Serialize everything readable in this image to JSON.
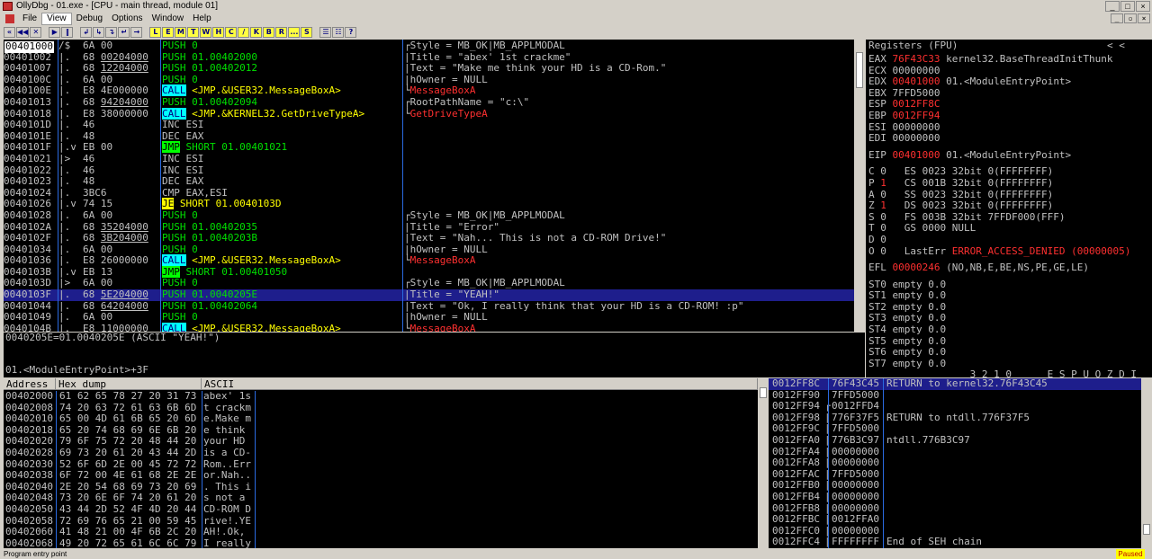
{
  "window": {
    "title": "OllyDbg - 01.exe - [CPU - main thread, module 01]"
  },
  "menu": [
    "File",
    "View",
    "Debug",
    "Options",
    "Window",
    "Help"
  ],
  "toolbar": {
    "buttons": [
      "«",
      "◀◀",
      "✕",
      "▶",
      "‖",
      "↲",
      "↳",
      "↴",
      "↵",
      "→"
    ],
    "letters": [
      "L",
      "E",
      "M",
      "T",
      "W",
      "H",
      "C",
      "/",
      "K",
      "B",
      "R",
      "...",
      "S"
    ],
    "right": [
      "☰",
      "☷",
      "?"
    ]
  },
  "disasm": {
    "rows": [
      {
        "addr": "00401000",
        "mark": "/$",
        "hex": "6A 00",
        "hexul": "",
        "asm": [
          {
            "t": "PUSH 0",
            "c": "g"
          }
        ],
        "cmt": [
          {
            "t": "┌Style = MB_OK|MB_APPLMODAL",
            "c": "w"
          }
        ]
      },
      {
        "addr": "00401002",
        "mark": "|.",
        "hex": "68 ",
        "hexul": "00204000",
        "asm": [
          {
            "t": "PUSH 01.00402000",
            "c": "g"
          }
        ],
        "cmt": [
          {
            "t": "|Title = \"abex' 1st crackme\"",
            "c": "w"
          }
        ]
      },
      {
        "addr": "00401007",
        "mark": "|.",
        "hex": "68 ",
        "hexul": "12204000",
        "asm": [
          {
            "t": "PUSH 01.00402012",
            "c": "g"
          }
        ],
        "cmt": [
          {
            "t": "|Text = \"Make me think your HD is a CD-Rom.\"",
            "c": "w"
          }
        ]
      },
      {
        "addr": "0040100C",
        "mark": "|.",
        "hex": "6A 00",
        "hexul": "",
        "asm": [
          {
            "t": "PUSH 0",
            "c": "g"
          }
        ],
        "cmt": [
          {
            "t": "|hOwner = NULL",
            "c": "w"
          }
        ]
      },
      {
        "addr": "0040100E",
        "mark": "|.",
        "hex": "E8 4E000000",
        "hexul": "",
        "asm": [
          {
            "t": "CALL",
            "c": "callhl"
          },
          {
            "t": " <JMP.&USER32.MessageBoxA>",
            "c": "y"
          }
        ],
        "cmt": [
          {
            "t": "└",
            "c": "w"
          },
          {
            "t": "MessageBoxA",
            "c": "r"
          }
        ]
      },
      {
        "addr": "00401013",
        "mark": "|.",
        "hex": "68 ",
        "hexul": "94204000",
        "asm": [
          {
            "t": "PUSH 01.00402094",
            "c": "g"
          }
        ],
        "cmt": [
          {
            "t": "┌RootPathName = \"c:\\\"",
            "c": "w"
          }
        ]
      },
      {
        "addr": "00401018",
        "mark": "|.",
        "hex": "E8 38000000",
        "hexul": "",
        "asm": [
          {
            "t": "CALL",
            "c": "callhl"
          },
          {
            "t": " <JMP.&KERNEL32.GetDriveTypeA>",
            "c": "y"
          }
        ],
        "cmt": [
          {
            "t": "└",
            "c": "w"
          },
          {
            "t": "GetDriveTypeA",
            "c": "r"
          }
        ]
      },
      {
        "addr": "0040101D",
        "mark": "|.",
        "hex": "46",
        "hexul": "",
        "asm": [
          {
            "t": "INC ESI",
            "c": "w"
          }
        ],
        "cmt": []
      },
      {
        "addr": "0040101E",
        "mark": "|.",
        "hex": "48",
        "hexul": "",
        "asm": [
          {
            "t": "DEC EAX",
            "c": "w"
          }
        ],
        "cmt": []
      },
      {
        "addr": "0040101F",
        "mark": "|.v",
        "hex": "EB 00",
        "hexul": "",
        "asm": [
          {
            "t": "JMP",
            "c": "jmphl"
          },
          {
            "t": " SHORT 01.00401021",
            "c": "g"
          }
        ],
        "cmt": []
      },
      {
        "addr": "00401021",
        "mark": "|>",
        "hex": "46",
        "hexul": "",
        "asm": [
          {
            "t": "INC ESI",
            "c": "w"
          }
        ],
        "cmt": []
      },
      {
        "addr": "00401022",
        "mark": "|.",
        "hex": "46",
        "hexul": "",
        "asm": [
          {
            "t": "INC ESI",
            "c": "w"
          }
        ],
        "cmt": []
      },
      {
        "addr": "00401023",
        "mark": "|.",
        "hex": "48",
        "hexul": "",
        "asm": [
          {
            "t": "DEC EAX",
            "c": "w"
          }
        ],
        "cmt": []
      },
      {
        "addr": "00401024",
        "mark": "|.",
        "hex": "3BC6",
        "hexul": "",
        "asm": [
          {
            "t": "CMP EAX,ESI",
            "c": "w"
          }
        ],
        "cmt": []
      },
      {
        "addr": "00401026",
        "mark": "|.v",
        "hex": "74 15",
        "hexul": "",
        "asm": [
          {
            "t": "JE",
            "c": "jehl"
          },
          {
            "t": " SHORT 01.0040103D",
            "c": "y"
          }
        ],
        "cmt": []
      },
      {
        "addr": "00401028",
        "mark": "|.",
        "hex": "6A 00",
        "hexul": "",
        "asm": [
          {
            "t": "PUSH 0",
            "c": "g"
          }
        ],
        "cmt": [
          {
            "t": "┌Style = MB_OK|MB_APPLMODAL",
            "c": "w"
          }
        ]
      },
      {
        "addr": "0040102A",
        "mark": "|.",
        "hex": "68 ",
        "hexul": "35204000",
        "asm": [
          {
            "t": "PUSH 01.00402035",
            "c": "g"
          }
        ],
        "cmt": [
          {
            "t": "|Title = \"Error\"",
            "c": "w"
          }
        ]
      },
      {
        "addr": "0040102F",
        "mark": "|.",
        "hex": "68 ",
        "hexul": "3B204000",
        "asm": [
          {
            "t": "PUSH 01.0040203B",
            "c": "g"
          }
        ],
        "cmt": [
          {
            "t": "|Text = \"Nah... This is not a CD-ROM Drive!\"",
            "c": "w"
          }
        ]
      },
      {
        "addr": "00401034",
        "mark": "|.",
        "hex": "6A 00",
        "hexul": "",
        "asm": [
          {
            "t": "PUSH 0",
            "c": "g"
          }
        ],
        "cmt": [
          {
            "t": "|hOwner = NULL",
            "c": "w"
          }
        ]
      },
      {
        "addr": "00401036",
        "mark": "|.",
        "hex": "E8 26000000",
        "hexul": "",
        "asm": [
          {
            "t": "CALL",
            "c": "callhl"
          },
          {
            "t": " <JMP.&USER32.MessageBoxA>",
            "c": "y"
          }
        ],
        "cmt": [
          {
            "t": "└",
            "c": "w"
          },
          {
            "t": "MessageBoxA",
            "c": "r"
          }
        ]
      },
      {
        "addr": "0040103B",
        "mark": "|.v",
        "hex": "EB 13",
        "hexul": "",
        "asm": [
          {
            "t": "JMP",
            "c": "jmphl"
          },
          {
            "t": " SHORT 01.00401050",
            "c": "g"
          }
        ],
        "cmt": []
      },
      {
        "addr": "0040103D",
        "mark": "|>",
        "hex": "6A 00",
        "hexul": "",
        "asm": [
          {
            "t": "PUSH 0",
            "c": "g"
          }
        ],
        "cmt": [
          {
            "t": "┌Style = MB_OK|MB_APPLMODAL",
            "c": "w"
          }
        ]
      },
      {
        "addr": "0040103F",
        "mark": "|.",
        "hex": "68 ",
        "hexul": "5E204000",
        "asm": [
          {
            "t": "PUSH 01.0040205E",
            "c": "g"
          }
        ],
        "cmt": [
          {
            "t": "|Title = \"YEAH!\"",
            "c": "w"
          }
        ],
        "selected": true
      },
      {
        "addr": "00401044",
        "mark": "|.",
        "hex": "68 ",
        "hexul": "64204000",
        "asm": [
          {
            "t": "PUSH 01.00402064",
            "c": "g"
          }
        ],
        "cmt": [
          {
            "t": "|Text = \"Ok, I really think that your HD is a CD-ROM! :p\"",
            "c": "w"
          }
        ]
      },
      {
        "addr": "00401049",
        "mark": "|.",
        "hex": "6A 00",
        "hexul": "",
        "asm": [
          {
            "t": "PUSH 0",
            "c": "g"
          }
        ],
        "cmt": [
          {
            "t": "|hOwner = NULL",
            "c": "w"
          }
        ]
      },
      {
        "addr": "0040104B",
        "mark": "|.",
        "hex": "E8 11000000",
        "hexul": "",
        "asm": [
          {
            "t": "CALL",
            "c": "callhl"
          },
          {
            "t": " <JMP.&USER32.MessageBoxA>",
            "c": "y"
          }
        ],
        "cmt": [
          {
            "t": "└",
            "c": "w"
          },
          {
            "t": "MessageBoxA",
            "c": "r"
          }
        ]
      }
    ]
  },
  "info": {
    "line1": "0040205E=01.0040205E (ASCII \"YEAH!\")",
    "line2": "01.<ModuleEntryPoint>+3F"
  },
  "registers": {
    "header": "Registers (FPU)",
    "header_arrows": "<          <",
    "lines": [
      [
        {
          "t": "EAX ",
          "c": "w"
        },
        {
          "t": "76F43C33",
          "c": "r"
        },
        {
          "t": " kernel32.BaseThreadInitThunk",
          "c": "w"
        }
      ],
      [
        {
          "t": "ECX 00000000",
          "c": "w"
        }
      ],
      [
        {
          "t": "EDX ",
          "c": "w"
        },
        {
          "t": "00401000",
          "c": "r"
        },
        {
          "t": " 01.<ModuleEntryPoint>",
          "c": "w"
        }
      ],
      [
        {
          "t": "EBX 7FFD5000",
          "c": "w"
        }
      ],
      [
        {
          "t": "ESP ",
          "c": "w"
        },
        {
          "t": "0012FF8C",
          "c": "r"
        }
      ],
      [
        {
          "t": "EBP ",
          "c": "w"
        },
        {
          "t": "0012FF94",
          "c": "r"
        }
      ],
      [
        {
          "t": "ESI 00000000",
          "c": "w"
        }
      ],
      [
        {
          "t": "EDI 00000000",
          "c": "w"
        }
      ],
      [],
      [
        {
          "t": "EIP ",
          "c": "w"
        },
        {
          "t": "00401000",
          "c": "r"
        },
        {
          "t": " 01.<ModuleEntryPoint>",
          "c": "w"
        }
      ],
      [],
      [
        {
          "t": "C 0   ES 0023 32bit 0(FFFFFFFF)",
          "c": "w"
        }
      ],
      [
        {
          "t": "P ",
          "c": "w"
        },
        {
          "t": "1",
          "c": "r"
        },
        {
          "t": "   CS 001B 32bit 0(FFFFFFFF)",
          "c": "w"
        }
      ],
      [
        {
          "t": "A 0   SS 0023 32bit 0(FFFFFFFF)",
          "c": "w"
        }
      ],
      [
        {
          "t": "Z ",
          "c": "w"
        },
        {
          "t": "1",
          "c": "r"
        },
        {
          "t": "   DS 0023 32bit 0(FFFFFFFF)",
          "c": "w"
        }
      ],
      [
        {
          "t": "S 0   FS 003B 32bit 7FFDF000(FFF)",
          "c": "w"
        }
      ],
      [
        {
          "t": "T 0   GS 0000 NULL",
          "c": "w"
        }
      ],
      [
        {
          "t": "D 0",
          "c": "w"
        }
      ],
      [
        {
          "t": "O 0   LastErr ",
          "c": "w"
        },
        {
          "t": "ERROR_ACCESS_DENIED (00000005)",
          "c": "r"
        }
      ],
      [],
      [
        {
          "t": "EFL ",
          "c": "w"
        },
        {
          "t": "00000246",
          "c": "r"
        },
        {
          "t": " (NO,NB,E,BE,NS,PE,GE,LE)",
          "c": "w"
        }
      ],
      [],
      [
        {
          "t": "ST0 empty 0.0",
          "c": "w"
        }
      ],
      [
        {
          "t": "ST1 empty 0.0",
          "c": "w"
        }
      ],
      [
        {
          "t": "ST2 empty 0.0",
          "c": "w"
        }
      ],
      [
        {
          "t": "ST3 empty 0.0",
          "c": "w"
        }
      ],
      [
        {
          "t": "ST4 empty 0.0",
          "c": "w"
        }
      ],
      [
        {
          "t": "ST5 empty 0.0",
          "c": "w"
        }
      ],
      [
        {
          "t": "ST6 empty 0.0",
          "c": "w"
        }
      ],
      [
        {
          "t": "ST7 empty 0.0",
          "c": "w"
        }
      ],
      [
        {
          "t": "                 3 2 1 0      E S P U O Z D I",
          "c": "w"
        }
      ]
    ]
  },
  "dump": {
    "headers": [
      "Address",
      "Hex dump",
      "ASCII"
    ],
    "rows": [
      [
        "00402000",
        "61 62 65 78 27 20 31 73",
        "abex' 1s"
      ],
      [
        "00402008",
        "74 20 63 72 61 63 6B 6D",
        "t crackm"
      ],
      [
        "00402010",
        "65 00 4D 61 6B 65 20 6D",
        "e.Make m"
      ],
      [
        "00402018",
        "65 20 74 68 69 6E 6B 20",
        "e think "
      ],
      [
        "00402020",
        "79 6F 75 72 20 48 44 20",
        "your HD "
      ],
      [
        "00402028",
        "69 73 20 61 20 43 44 2D",
        "is a CD-"
      ],
      [
        "00402030",
        "52 6F 6D 2E 00 45 72 72",
        "Rom..Err"
      ],
      [
        "00402038",
        "6F 72 00 4E 61 68 2E 2E",
        "or.Nah.."
      ],
      [
        "00402040",
        "2E 20 54 68 69 73 20 69",
        ". This i"
      ],
      [
        "00402048",
        "73 20 6E 6F 74 20 61 20",
        "s not a "
      ],
      [
        "00402050",
        "43 44 2D 52 4F 4D 20 44",
        "CD-ROM D"
      ],
      [
        "00402058",
        "72 69 76 65 21 00 59 45",
        "rive!.YE"
      ],
      [
        "00402060",
        "41 48 21 00 4F 6B 2C 20",
        "AH!.Ok, "
      ],
      [
        "00402068",
        "49 20 72 65 61 6C 6C 79",
        "I really"
      ]
    ]
  },
  "stack": {
    "rows": [
      {
        "addr": "0012FF8C",
        "val": "76F43C45",
        "cmt": "RETURN to kernel32.76F43C45",
        "selected": true,
        "mark": ""
      },
      {
        "addr": "0012FF90",
        "val": "7FFD5000",
        "cmt": "",
        "mark": ""
      },
      {
        "addr": "0012FF94",
        "val": "0012FFD4",
        "cmt": "",
        "mark": "┌"
      },
      {
        "addr": "0012FF98",
        "val": "776F37F5",
        "cmt": "RETURN to ntdll.776F37F5",
        "mark": "|"
      },
      {
        "addr": "0012FF9C",
        "val": "7FFD5000",
        "cmt": "",
        "mark": "|"
      },
      {
        "addr": "0012FFA0",
        "val": "776B3C97",
        "cmt": "ntdll.776B3C97",
        "mark": "|"
      },
      {
        "addr": "0012FFA4",
        "val": "00000000",
        "cmt": "",
        "mark": "|"
      },
      {
        "addr": "0012FFA8",
        "val": "00000000",
        "cmt": "",
        "mark": "|"
      },
      {
        "addr": "0012FFAC",
        "val": "7FFD5000",
        "cmt": "",
        "mark": "|"
      },
      {
        "addr": "0012FFB0",
        "val": "00000000",
        "cmt": "",
        "mark": "|"
      },
      {
        "addr": "0012FFB4",
        "val": "00000000",
        "cmt": "",
        "mark": "|"
      },
      {
        "addr": "0012FFB8",
        "val": "00000000",
        "cmt": "",
        "mark": "|"
      },
      {
        "addr": "0012FFBC",
        "val": "0012FFA0",
        "cmt": "",
        "mark": "|"
      },
      {
        "addr": "0012FFC0",
        "val": "00000000",
        "cmt": "",
        "mark": "|"
      },
      {
        "addr": "0012FFC4",
        "val": "FFFFFFFF",
        "cmt": "End of SEH chain",
        "mark": "|"
      }
    ]
  },
  "status": {
    "text": "Program entry point",
    "state": "Paused"
  }
}
